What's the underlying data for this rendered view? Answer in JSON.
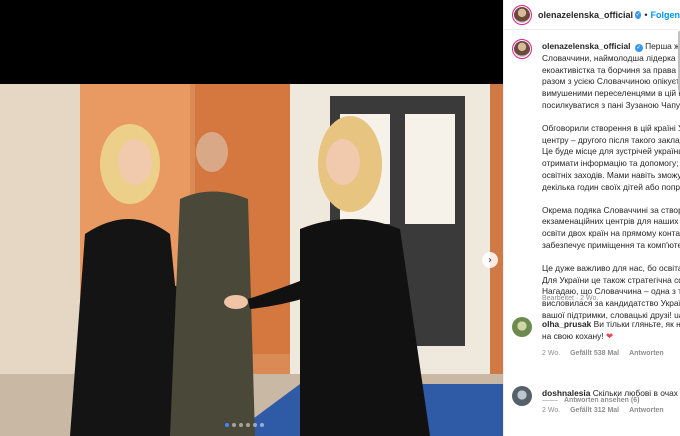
{
  "post": {
    "username": "olenazelenska_official",
    "follow_label": "Folgen",
    "separator": "•"
  },
  "caption": {
    "lines_p1": [
      "Перша жінка",
      "Словаччини, наймолодша лідерка в іс",
      "екоактивістка та борчиня за права лю",
      "разом з усією Словаччиною опікуєтьс",
      "вимушеними переселенцями в цій кр",
      "посилкуватися з пані Зузаною Чапуто"
    ],
    "lines_p2": [
      "Обговорили створення в цій країні Ук",
      "центру – другого після такого заклад",
      "Це буде місце для зустрічей українців",
      "отримати інформацію та допомогу; м",
      "освітніх заходів. Мами навіть зможуть",
      "декілька годин своїх дітей або попрац"
    ],
    "lines_p3": [
      "Окрема подяка Словаччині за створе",
      "екзаменаційних центрів для наших аб",
      "освіти двох країн на прямому контакт",
      "забезпечує приміщення та комп'ютер"
    ],
    "lines_p4": [
      "Це дуже важливо для нас, бо освіта н",
      "Для України це також стратегічна сфе",
      "Нагадаю, що Словаччина – одна з тих",
      "висловилася за кандидатство України",
      "вашої підтримки, словацькі друзі! uas"
    ],
    "meta": "Bearbeitet · 2 Wo."
  },
  "comments": [
    {
      "user": "olha_prusak",
      "text_line1": "Ви тільки гляньте, як наш",
      "text_line2": "на свою кохану!",
      "heart": "❤",
      "age": "2 Wo.",
      "likes": "Gefällt 538 Mal",
      "reply": "Antworten",
      "view_replies": "Antworten ansehen (6)"
    },
    {
      "user": "doshnalesia",
      "text_line1": "Скільки любові в очах чо",
      "age": "2 Wo.",
      "likes": "Gefällt 312 Mal",
      "reply": "Antworten"
    }
  ],
  "carousel": {
    "next_icon": "chevron-right-icon",
    "total": 6,
    "active": 0
  },
  "colors": {
    "link": "#0095f6",
    "verified": "#3897f0",
    "heart": "#ed4956",
    "active_dot": "#3b8cf0"
  }
}
